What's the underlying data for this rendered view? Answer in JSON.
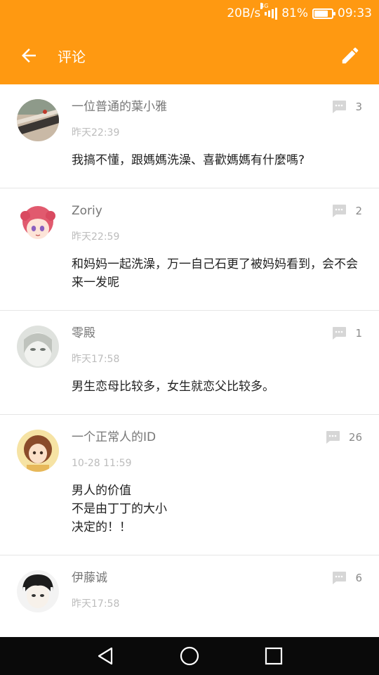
{
  "status_bar": {
    "speed": "20B/s",
    "network": "4G",
    "battery": "81%",
    "battery_level": 0.81,
    "time": "09:33"
  },
  "app_bar": {
    "title": "评论",
    "back_icon": "arrow-left-icon",
    "edit_icon": "pencil-icon",
    "bg_color": "#FF9911"
  },
  "comments": [
    {
      "username": "一位普通的葉小雅",
      "time": "昨天22:39",
      "content": "我搞不懂，跟媽媽洗澡、喜歡媽媽有什麼嗎?",
      "replies": "3"
    },
    {
      "username": "Zoriy",
      "time": "昨天22:59",
      "content": "和妈妈一起洗澡，万一自己石更了被妈妈看到，会不会来一发呢",
      "replies": "2"
    },
    {
      "username": "零殿",
      "time": "昨天17:58",
      "content": "男生恋母比较多，女生就恋父比较多。",
      "replies": "1"
    },
    {
      "username": "一个正常人的ID",
      "time": "10-28 11:59",
      "content": "男人的价值\n不是由丁丁的大小\n决定的！！",
      "replies": "26"
    },
    {
      "username": "伊藤诚",
      "time": "昨天17:58",
      "content": "",
      "replies": "6"
    }
  ],
  "nav_bar": {
    "back_icon": "triangle-back-icon",
    "home_icon": "circle-home-icon",
    "recents_icon": "square-recents-icon"
  }
}
